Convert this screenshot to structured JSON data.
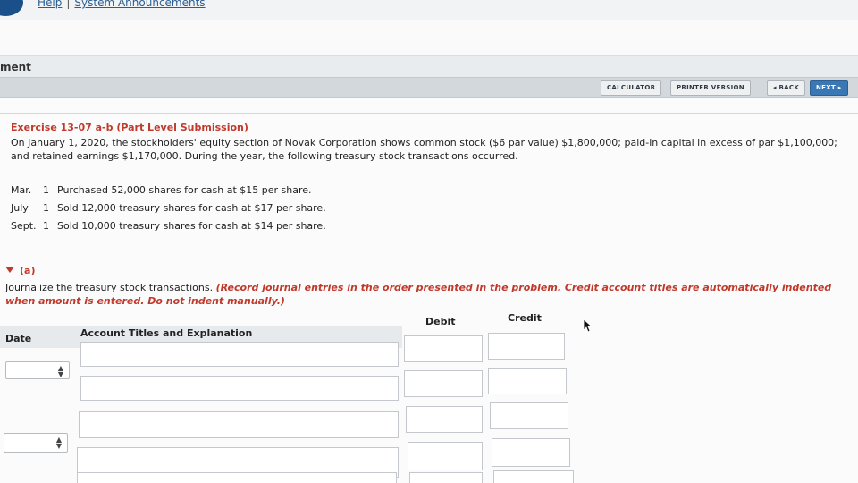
{
  "top_links": {
    "help": "Help",
    "separator": "|",
    "announcements": "System Announcements"
  },
  "section_title": "ment",
  "toolbar": {
    "calculator": "CALCULATOR",
    "printer": "PRINTER VERSION",
    "back": "◂ BACK",
    "next": "NEXT ▸"
  },
  "exercise": {
    "title": "Exercise 13-07 a-b (Part Level Submission)",
    "body": "On January 1, 2020, the stockholders' equity section of Novak Corporation shows common stock ($6 par value) $1,800,000; paid-in capital in excess of par $1,100,000; and retained earnings $1,170,000. During the year, the following treasury stock transactions occurred.",
    "transactions": [
      {
        "month": "Mar.",
        "day": "1",
        "text": "Purchased 52,000 shares for cash at $15 per share."
      },
      {
        "month": "July",
        "day": "1",
        "text": "Sold 12,000 treasury shares for cash at $17 per share."
      },
      {
        "month": "Sept.",
        "day": "1",
        "text": "Sold 10,000 treasury shares for cash at $14 per share."
      }
    ]
  },
  "part": {
    "label": "(a)",
    "instruction": "Journalize the treasury stock transactions.",
    "note": "(Record journal entries in the order presented in the problem. Credit account titles are automatically indented when amount is entered. Do not indent manually.)"
  },
  "table": {
    "col_date": "Date",
    "col_account": "Account Titles and Explanation",
    "col_debit": "Debit",
    "col_credit": "Credit"
  },
  "colors": {
    "accent_red": "#c0392b",
    "next_button": "#3a78b5",
    "link_blue": "#2a5e93"
  }
}
